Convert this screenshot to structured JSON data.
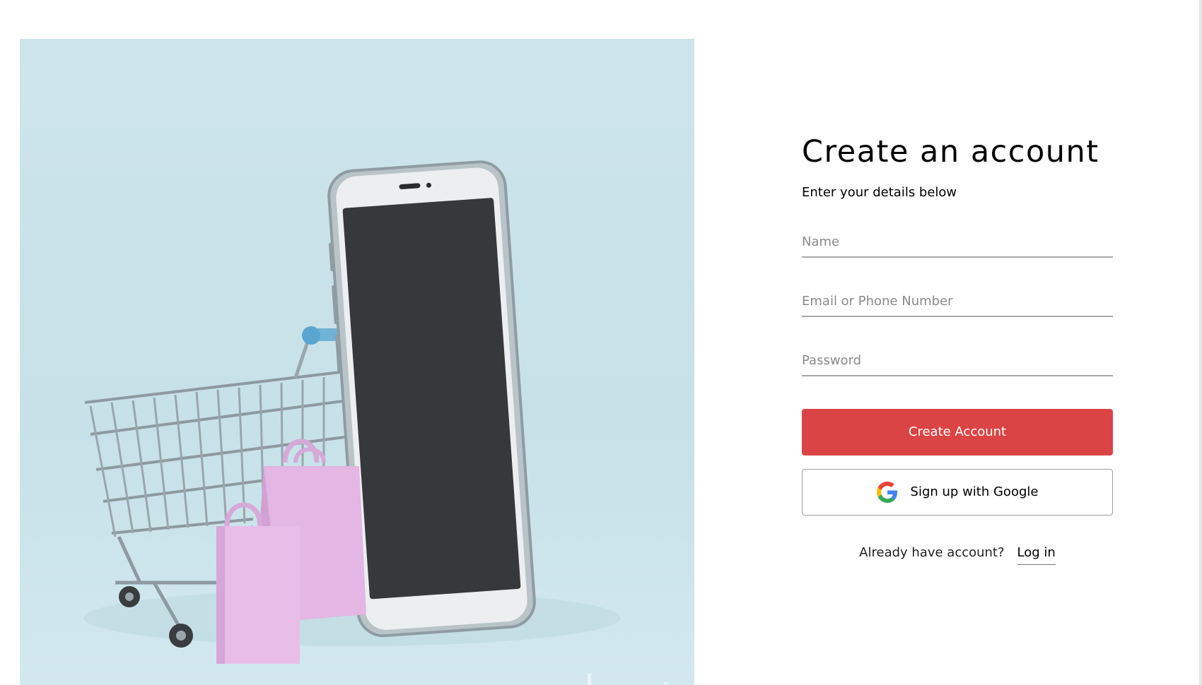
{
  "hero": {
    "image_description": "phone-shopping-cart-illustration",
    "watermark": "خمسات"
  },
  "form": {
    "title": "Create an account",
    "subtitle": "Enter your details below",
    "fields": {
      "name_placeholder": "Name",
      "email_placeholder": "Email or Phone Number",
      "password_placeholder": "Password"
    },
    "create_button": "Create Account",
    "google_button": "Sign up with Google",
    "login_prompt": "Already have account?",
    "login_link": "Log in"
  },
  "colors": {
    "accent": "#db4444",
    "hero_bg": "#c9e2e9"
  }
}
